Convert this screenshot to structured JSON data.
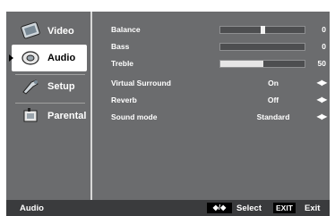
{
  "menu": {
    "items": [
      {
        "label": "Video",
        "icon": "video-icon",
        "selected": false
      },
      {
        "label": "Audio",
        "icon": "audio-icon",
        "selected": true
      },
      {
        "label": "Setup",
        "icon": "setup-icon",
        "selected": false
      },
      {
        "label": "Parental",
        "icon": "parental-icon",
        "selected": false
      }
    ]
  },
  "settings": {
    "balance": {
      "label": "Balance",
      "value": "0",
      "level": 0.5
    },
    "bass": {
      "label": "Bass",
      "value": "0",
      "level": 0.0
    },
    "treble": {
      "label": "Treble",
      "value": "50",
      "level": 0.5
    },
    "virtual_surround": {
      "label": "Virtual Surround",
      "value": "On"
    },
    "reverb": {
      "label": "Reverb",
      "value": "Off"
    },
    "sound_mode": {
      "label": "Sound mode",
      "value": "Standard"
    },
    "arrows_glyph": "◀▶"
  },
  "footer": {
    "title": "Audio",
    "nav_glyph": "◆/◆",
    "select_label": "Select",
    "exit_key": "EXIT",
    "exit_label": "Exit"
  },
  "colors": {
    "panel": "#6b6c6e",
    "footer": "#3a3b3d",
    "highlight": "#ffffff"
  }
}
